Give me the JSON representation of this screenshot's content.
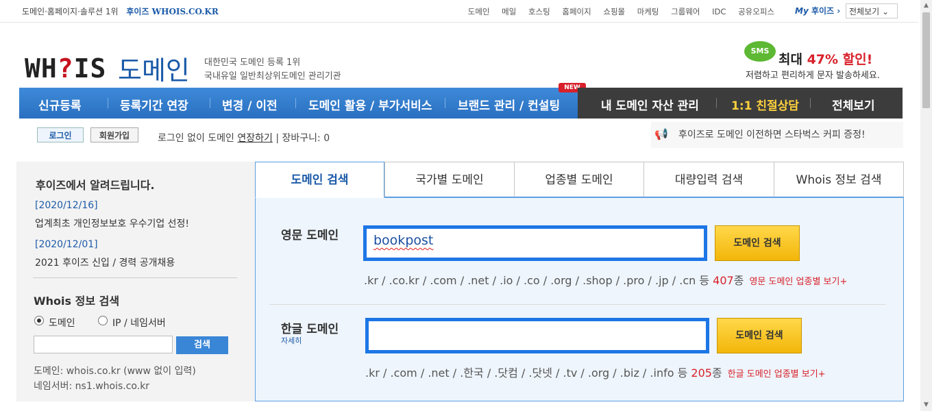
{
  "topbar": {
    "left_text": "도메인·홈페이지·솔루션 1위",
    "brand": "후이즈 WHOIS.CO.KR",
    "links": [
      "도메인",
      "메일",
      "호스팅",
      "홈페이지",
      "쇼핑몰",
      "마케팅",
      "그룹웨어",
      "IDC",
      "공유오피스"
    ],
    "my_prefix": "My",
    "my_label": "후이즈 ›",
    "view_all": "전체보기 ⌄"
  },
  "header": {
    "logo_left": "WH",
    "logo_q": "?",
    "logo_right": "IS",
    "logo_domain": "도메인",
    "tagline1": "대한민국 도메인 등록 1위",
    "tagline2": "국내유일 일반최상위도메인 관리기관"
  },
  "ad": {
    "badge": "SMS",
    "title_pre": "최대 ",
    "title_highlight": "47% 할인!",
    "desc": "저렴하고 편리하게 문자 발송하세요."
  },
  "nav": {
    "items": [
      "신규등록",
      "등록기간 연장",
      "변경 / 이전",
      "도메인 활용 / 부가서비스",
      "브랜드 관리 / 컨설팅"
    ],
    "new_badge": "NEW",
    "right_items": [
      "내 도메인 자산 관리",
      "1:1 친절상담",
      "전체보기"
    ]
  },
  "account": {
    "login": "로그인",
    "signup": "회원가입",
    "msg_pre": "로그인 없이 도메인 ",
    "msg_link": "연장하기",
    "msg_post": "  |  장바구니: 0"
  },
  "notice_ticker": {
    "text": "후이즈로 도메인 이전하면 스타벅스 커피 증정!"
  },
  "left": {
    "heading": "후이즈에서 알려드립니다.",
    "news": [
      {
        "date": "[2020/12/16]",
        "title": "업계최초 개인정보보호 우수기업 선정!"
      },
      {
        "date": "[2020/12/01]",
        "title": "2021 후이즈 신입 / 경력 공개채용"
      }
    ],
    "whois_heading": "Whois 정보 검색",
    "radio_domain": "도메인",
    "radio_ip": "IP / 네임서버",
    "search_button": "검색",
    "hint1": "도메인: whois.co.kr (www 없이 입력)",
    "hint2": "네임서버: ns1.whois.co.kr"
  },
  "tabs": [
    "도메인 검색",
    "국가별 도메인",
    "업종별 도메인",
    "대량입력 검색",
    "Whois 정보 검색"
  ],
  "search": {
    "en_label": "영문 도메인",
    "en_value": "bookpost",
    "en_button": "도메인 검색",
    "en_exts": ".kr / .co.kr / .com / .net / .io / .co / .org / .shop / .pro / .jp / .cn 등 ",
    "en_count": "407",
    "en_count_suffix": "종",
    "en_more": "영문 도메인 업종별 보기+",
    "kr_label": "한글 도메인",
    "kr_detail": "자세히",
    "kr_value": "",
    "kr_button": "도메인 검색",
    "kr_exts": ".kr / .com / .net / .한국 / .닷컴 / .닷넷 / .tv / .org / .biz / .info 등 ",
    "kr_count": "205",
    "kr_count_suffix": "종",
    "kr_more": "한글 도메인 업종별 보기+"
  },
  "colors": {
    "brand_blue": "#1b5aa8",
    "nav_blue": "#2a6fc1",
    "accent_red": "#d8202a",
    "search_border": "#1d76e6",
    "button_yellow": "#f3b60a"
  }
}
